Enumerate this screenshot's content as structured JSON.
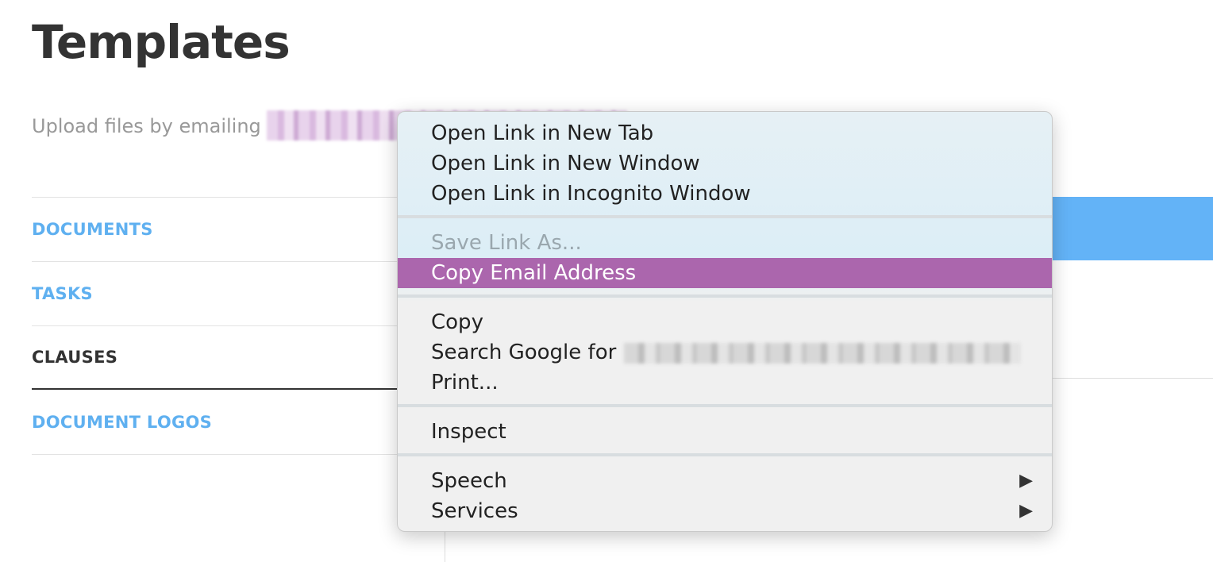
{
  "page": {
    "title": "Templates",
    "upload_prefix": "Upload files by emailing"
  },
  "nav": {
    "items": [
      {
        "label": "DOCUMENTS"
      },
      {
        "label": "TASKS"
      },
      {
        "label": "CLAUSES"
      },
      {
        "label": "DOCUMENT LOGOS"
      }
    ],
    "active": "CLAUSES"
  },
  "context_menu": {
    "open_new_tab": "Open Link in New Tab",
    "open_new_window": "Open Link in New Window",
    "open_incognito": "Open Link in Incognito Window",
    "save_link_as": "Save Link As...",
    "copy_email": "Copy Email Address",
    "copy": "Copy",
    "search_google_prefix": "Search Google for",
    "print": "Print...",
    "inspect": "Inspect",
    "speech": "Speech",
    "services": "Services",
    "submenu_arrow": "▶"
  },
  "colors": {
    "accent_link": "#5fb0f0",
    "highlight": "#ab66ad",
    "blue_bar": "#63b3f7"
  }
}
